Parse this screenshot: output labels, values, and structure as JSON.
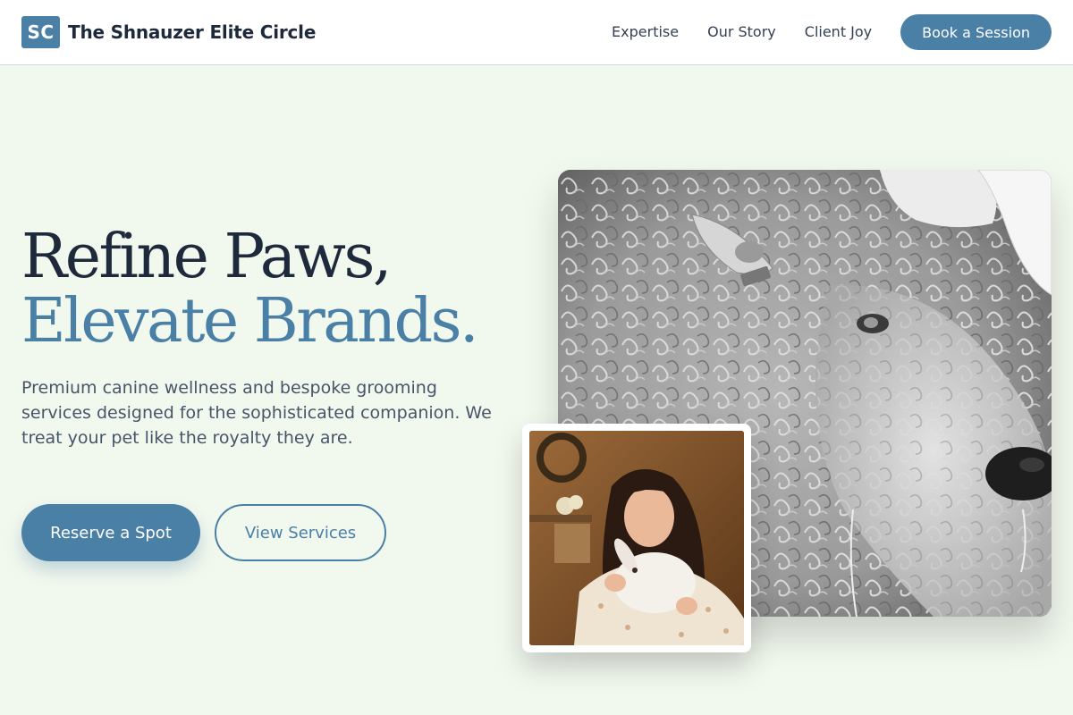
{
  "header": {
    "logo_initials": "SC",
    "brand_name": "The Shnauzer Elite Circle",
    "nav": [
      {
        "label": "Expertise"
      },
      {
        "label": "Our Story"
      },
      {
        "label": "Client Joy"
      }
    ],
    "cta_label": "Book a Session"
  },
  "hero": {
    "title_line1": "Refine Paws,",
    "title_line2": "Elevate Brands.",
    "description": "Premium canine wellness and bespoke grooming services designed for the sophisticated companion. We treat your pet like the royalty they are.",
    "primary_button": "Reserve a Spot",
    "secondary_button": "View Services"
  },
  "images": {
    "main_icon": "curly-sheep-photo",
    "inset_icon": "woman-holding-rabbit-photo"
  },
  "colors": {
    "accent": "#4a7fa6",
    "background": "#f1f8ee",
    "heading": "#1e293b",
    "body_text": "#475569"
  }
}
